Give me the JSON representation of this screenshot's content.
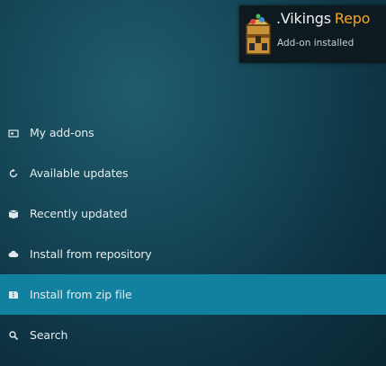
{
  "notification": {
    "title_part1": ".Vikings",
    "title_part2": "Repo",
    "subtitle": "Add-on installed",
    "icon": "treasure-chest-icon",
    "accent_color": "#f5a623"
  },
  "menu": {
    "selected_color": "#12809f",
    "items": [
      {
        "label": "My add-ons",
        "icon": "addons-box-icon"
      },
      {
        "label": "Available updates",
        "icon": "refresh-icon"
      },
      {
        "label": "Recently updated",
        "icon": "open-box-icon"
      },
      {
        "label": "Install from repository",
        "icon": "cloud-icon"
      },
      {
        "label": "Install from zip file",
        "icon": "zip-icon",
        "selected": true
      },
      {
        "label": "Search",
        "icon": "search-icon"
      }
    ]
  }
}
